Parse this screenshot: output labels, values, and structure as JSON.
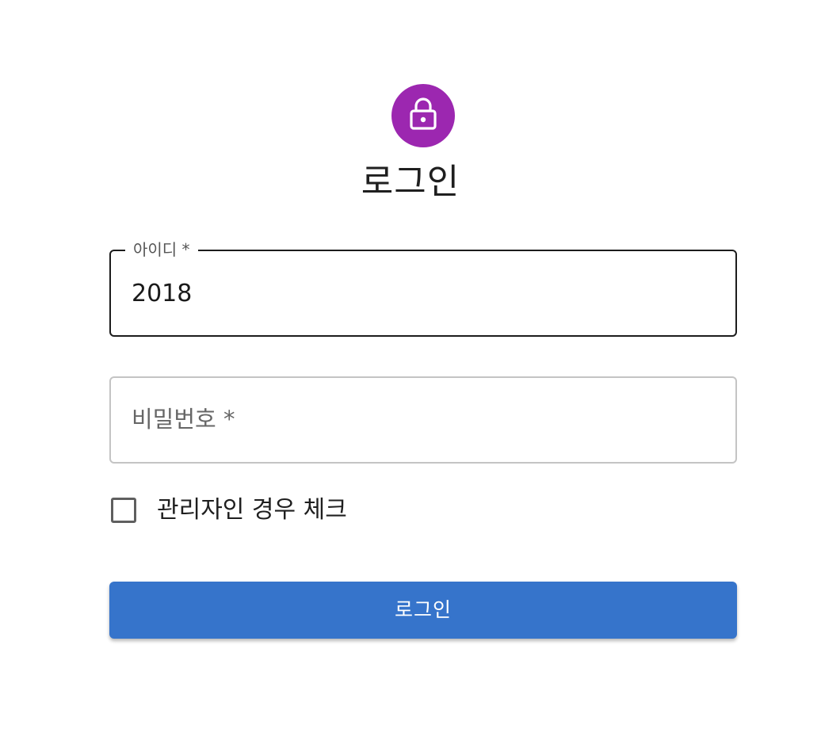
{
  "header": {
    "icon": "lock-icon",
    "icon_color": "#9c27b0",
    "title": "로그인"
  },
  "form": {
    "id_field": {
      "label": "아이디 *",
      "value": "2018"
    },
    "password_field": {
      "placeholder": "비밀번호 *",
      "value": ""
    },
    "admin_checkbox": {
      "label": "관리자인 경우 체크",
      "checked": false
    },
    "submit_label": "로그인",
    "submit_color": "#3674cb"
  }
}
